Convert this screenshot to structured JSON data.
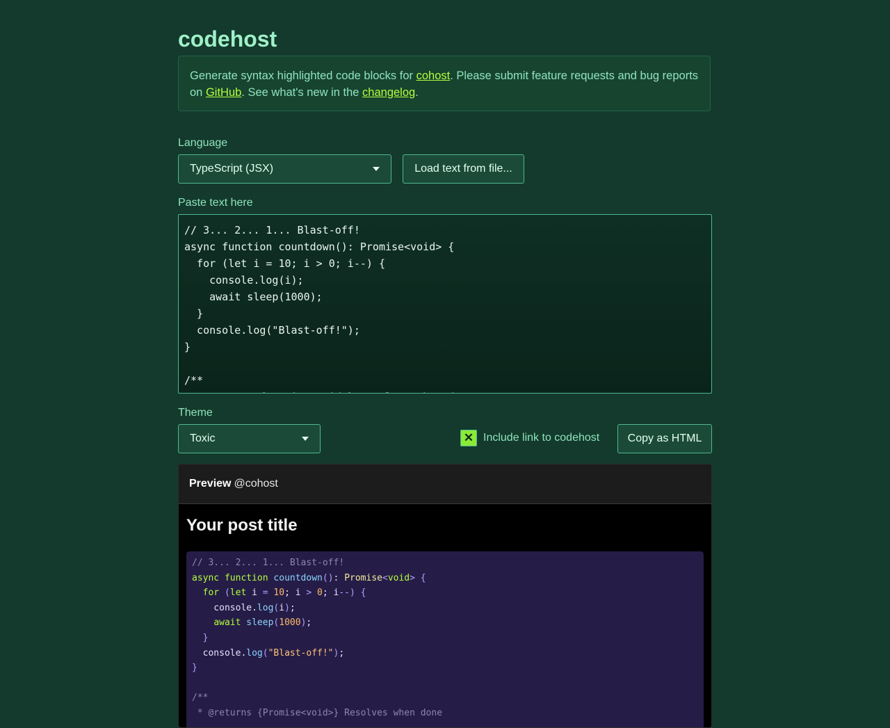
{
  "app": {
    "title": "codehost"
  },
  "intro": {
    "text_1": "Generate syntax highlighted code blocks for ",
    "link_cohost": "cohost",
    "text_2": ". Please submit feature requests and bug reports on ",
    "link_github": "GitHub",
    "text_3": ". See what's new in the ",
    "link_changelog": "changelog",
    "text_4": "."
  },
  "language": {
    "label": "Language",
    "selected": "TypeScript (JSX)"
  },
  "load_file_label": "Load text from file...",
  "input": {
    "label": "Paste text here",
    "lines": [
      "// 3... 2... 1... Blast-off!",
      "async function countdown(): Promise<void> {",
      "  for (let i = 10; i > 0; i--) {",
      "    console.log(i);",
      "    await sleep(1000);",
      "  }",
      "  console.log(\"Blast-off!\");",
      "}",
      "",
      "/**",
      " * @returns {Promise<void>} Resolves when done"
    ]
  },
  "theme": {
    "label": "Theme",
    "selected": "Toxic"
  },
  "include_link": {
    "label": "Include link to codehost",
    "checked": true,
    "mark": "✕"
  },
  "copy_label": "Copy as HTML",
  "preview": {
    "heading": "Preview",
    "handle": "@cohost",
    "post_title": "Your post title"
  },
  "colors": {
    "background": "#133a2c",
    "accent": "#b6ff3c",
    "text": "#8fe3bd",
    "code_bg": "#251d47"
  }
}
